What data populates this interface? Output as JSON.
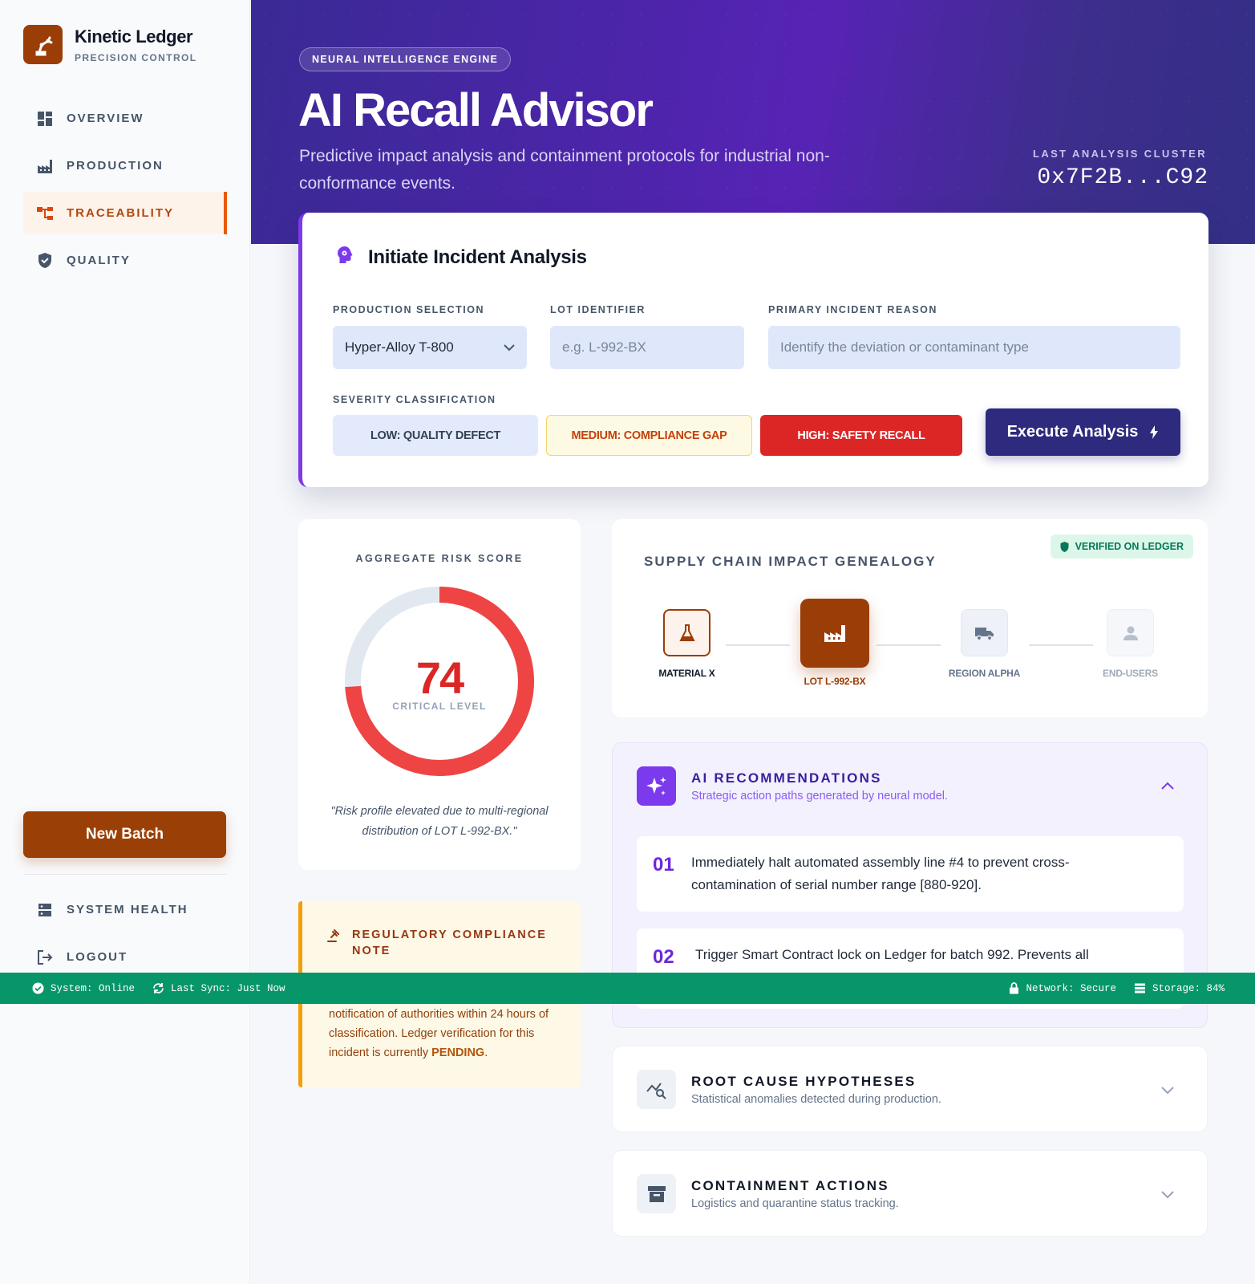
{
  "brand": {
    "name": "Kinetic Ledger",
    "subtitle": "PRECISION CONTROL"
  },
  "nav": {
    "items": [
      {
        "label": "OVERVIEW",
        "icon": "dashboard-icon",
        "active": false
      },
      {
        "label": "PRODUCTION",
        "icon": "factory-icon",
        "active": false
      },
      {
        "label": "TRACEABILITY",
        "icon": "hierarchy-icon",
        "active": true
      },
      {
        "label": "QUALITY",
        "icon": "shield-icon",
        "active": false
      }
    ],
    "new_batch_label": "New Batch",
    "bottom": [
      {
        "label": "SYSTEM HEALTH",
        "icon": "server-icon"
      },
      {
        "label": "LOGOUT",
        "icon": "logout-icon"
      }
    ]
  },
  "header": {
    "pill": "NEURAL INTELLIGENCE ENGINE",
    "title": "AI Recall Advisor",
    "subtitle": "Predictive impact analysis and containment protocols for industrial non-conformance events.",
    "cluster_label": "LAST ANALYSIS CLUSTER",
    "cluster_value": "0x7F2B...C92"
  },
  "analysis": {
    "title": "Initiate Incident Analysis",
    "product_label": "PRODUCTION SELECTION",
    "product_value": "Hyper-Alloy T-800",
    "lot_label": "LOT IDENTIFIER",
    "lot_placeholder": "e.g. L-992-BX",
    "reason_label": "PRIMARY INCIDENT REASON",
    "reason_placeholder": "Identify the deviation or contaminant type",
    "severity_label": "SEVERITY CLASSIFICATION",
    "severity": {
      "low": "LOW: QUALITY DEFECT",
      "medium": "MEDIUM: COMPLIANCE GAP",
      "high": "HIGH: SAFETY RECALL"
    },
    "execute_label": "Execute Analysis"
  },
  "risk": {
    "label": "AGGREGATE RISK SCORE",
    "score": "74",
    "score_fraction": 0.74,
    "level": "CRITICAL LEVEL",
    "quote": "\"Risk profile elevated due to multi-regional distribution of LOT L-992-BX.\""
  },
  "compliance": {
    "title": "REGULATORY COMPLIANCE NOTE",
    "body_pre": "notification of authorities within 24 hours of classification. Ledger verification for this incident is currently ",
    "body_status": "PENDING",
    "body_post": "."
  },
  "genealogy": {
    "title": "SUPPLY CHAIN IMPACT GENEALOGY",
    "verified": "VERIFIED ON LEDGER",
    "nodes": [
      {
        "label": "MATERIAL X",
        "icon": "flask-icon"
      },
      {
        "label": "LOT L-992-BX",
        "icon": "factory-icon"
      },
      {
        "label": "REGION ALPHA",
        "icon": "truck-icon"
      },
      {
        "label": "END-USERS",
        "icon": "user-icon"
      }
    ]
  },
  "ai": {
    "title": "AI RECOMMENDATIONS",
    "subtitle": "Strategic action paths generated by neural model.",
    "recs": [
      {
        "num": "01",
        "text": "Immediately halt automated assembly line #4 to prevent cross-contamination of serial number range [880-920]."
      },
      {
        "num": "02",
        "text": "Trigger Smart Contract lock on Ledger for batch 992. Prevents all"
      }
    ]
  },
  "root_cause": {
    "title": "ROOT CAUSE HYPOTHESES",
    "subtitle": "Statistical anomalies detected during production."
  },
  "containment": {
    "title": "CONTAINMENT ACTIONS",
    "subtitle": "Logistics and quarantine status tracking."
  },
  "status": {
    "system": "System: Online",
    "sync": "Last Sync: Just Now",
    "network": "Network: Secure",
    "storage": "Storage: 84%"
  },
  "colors": {
    "brand": "#9a3d06",
    "accent": "#7c3aed",
    "danger": "#dc2626",
    "status_bar": "#079669"
  }
}
